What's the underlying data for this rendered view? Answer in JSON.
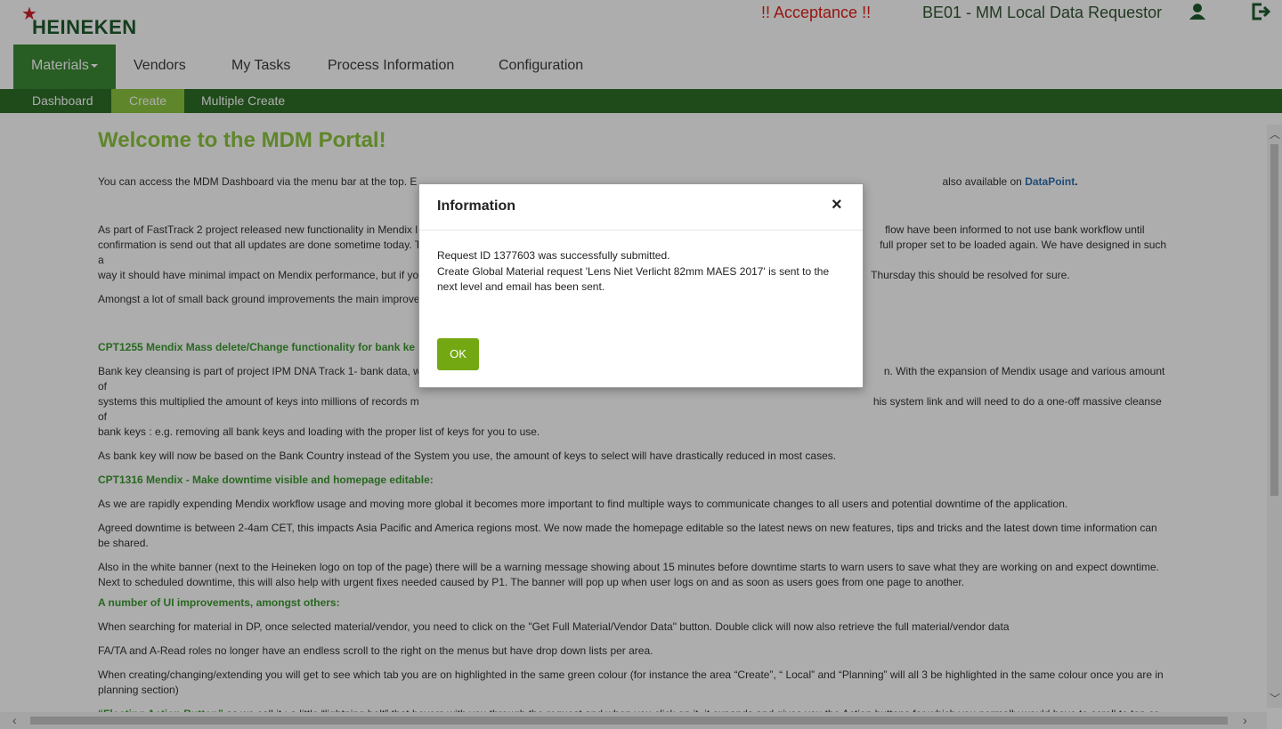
{
  "header": {
    "logo_text": "HEINEKEN",
    "env_warning": "!! Acceptance !!",
    "role_title": "BE01 - MM Local Data Requestor"
  },
  "nav": {
    "items": [
      {
        "label": "Materials"
      },
      {
        "label": "Vendors"
      },
      {
        "label": "My Tasks"
      },
      {
        "label": "Process Information"
      },
      {
        "label": "Configuration"
      }
    ]
  },
  "subnav": {
    "items": [
      {
        "label": "Dashboard"
      },
      {
        "label": "Create"
      },
      {
        "label": "Multiple Create"
      }
    ]
  },
  "content": {
    "title": "Welcome to the MDM Portal!",
    "p1_start": "You can access the MDM Dashboard via the menu bar at the top. E",
    "p1_end": "also available on",
    "p1_link": "DataPoint",
    "p2_line1_left": "As part of FastTrack 2 project released new functionality in Mendix l",
    "p2_line1_right": "flow have been informed to not use bank workflow until",
    "p2_line2_left": "confirmation is send out that all updates are done sometime today. T",
    "p2_line2_right": "full proper set to be loaded again. We have designed in such a",
    "p2_line3_left": "way it should have minimal impact on Mendix performance, but if yo",
    "p2_line3_right": "Thursday this should be resolved for sure.",
    "p3": "Amongst a lot of small back ground improvements the main improve",
    "cpt1255_title": "CPT1255   Mendix Mass delete/Change functionality for bank ke",
    "cpt1255_line1_left": "Bank key cleansing is part of project IPM DNA Track 1- bank data, w",
    "cpt1255_line1_right": "n. With the expansion of Mendix usage and various amount of",
    "cpt1255_line2_left": "systems this multiplied the amount of keys into millions of records m",
    "cpt1255_line2_right": "his system link and will need to do a one-off massive cleanse of",
    "cpt1255_line3": "bank keys : e.g. removing all bank keys and loading with the proper list of keys for you to use.",
    "cpt1255_p2": "As bank key will now be based on the Bank Country instead of the System you use, the amount of keys to select will have drastically reduced in most cases.",
    "cpt1316_title": "CPT1316  Mendix - Make downtime visible and homepage editable:",
    "cpt1316_p1": "As we are rapidly expending Mendix workflow usage and moving more global it becomes more important to find multiple ways to communicate changes to all users and potential downtime of the application.",
    "cpt1316_p2": "Agreed downtime is between 2-4am CET, this impacts Asia Pacific and America regions most. We now made the homepage editable so the latest news on new features, tips and tricks and the latest down time information can be shared.",
    "cpt1316_p3": "Also in the white banner (next to the Heineken logo on top of the page) there will be a warning message showing about 15 minutes before downtime starts to warn users to save what they are working on and expect downtime. Next to scheduled downtime, this will also help with urgent fixes needed caused by P1. The banner will pop up when user logs on and as soon as users goes from one page to another.",
    "ui_title": "A number of UI improvements, amongst others:",
    "bullets": [
      "When searching for material in DP, once selected material/vendor, you need to click on the \"Get Full Material/Vendor Data\" button. Double click will now also retrieve the full material/vendor data",
      "FA/TA and A-Read roles no longer have an endless scroll to the right on the menus but have drop down lists per area.",
      "When creating/changing/extending you will get to see which tab you are on highlighted in the same green colour (for instance the area “Create”, “ Local” and  “Planning” will all 3 be highlighted in the same colour once you are in planning section)"
    ],
    "bullet4_highlight": "“Floating Action Button”",
    "bullet4_rest": " as we call it :  a little “lightning bolt” that hovers with you through the request and when you click on it, it expands and gives you the Action buttons for which you normally would have to scroll to top or bottom."
  },
  "modal": {
    "title": "Information",
    "close_symbol": "×",
    "line1": "Request ID 1377603 was successfully submitted.",
    "line2": "Create Global Material request 'Lens Niet Verlicht 82mm MAES 2017' is sent to the next level and email has been sent.",
    "ok_label": "OK"
  },
  "colors": {
    "brand_green": "#2e6f27",
    "nav_active": "#3c8a34",
    "accent_lime": "#8cc63f",
    "ok_button": "#74a812",
    "warning_red": "#e0201a"
  },
  "icons": {
    "user": "user-icon",
    "logout": "logout-icon",
    "close": "close-icon"
  }
}
